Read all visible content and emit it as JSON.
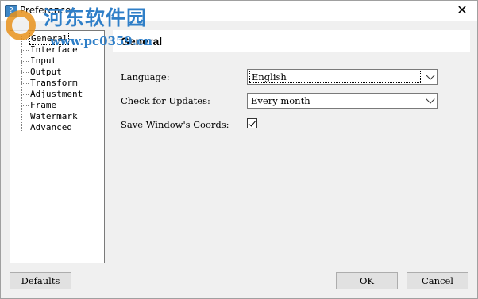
{
  "window": {
    "title": "Preferences",
    "close_glyph": "✕"
  },
  "watermark": {
    "text": "河东软件园",
    "url": "www.pc0359.cn"
  },
  "tree": {
    "items": [
      {
        "label": "General",
        "selected": true
      },
      {
        "label": "Interface"
      },
      {
        "label": "Input"
      },
      {
        "label": "Output"
      },
      {
        "label": "Transform"
      },
      {
        "label": "Adjustment"
      },
      {
        "label": "Frame"
      },
      {
        "label": "Watermark"
      },
      {
        "label": "Advanced"
      }
    ]
  },
  "panel": {
    "title": "General",
    "language": {
      "label": "Language:",
      "value": "English"
    },
    "updates": {
      "label": "Check for Updates:",
      "value": "Every month"
    },
    "save_coords": {
      "label": "Save Window's Coords:",
      "checked": true
    }
  },
  "buttons": {
    "defaults": "Defaults",
    "ok": "OK",
    "cancel": "Cancel"
  },
  "icons": {
    "app": "app-icon",
    "close": "close-icon",
    "dropdown": "chevron-down-icon",
    "check": "checkmark-icon"
  }
}
